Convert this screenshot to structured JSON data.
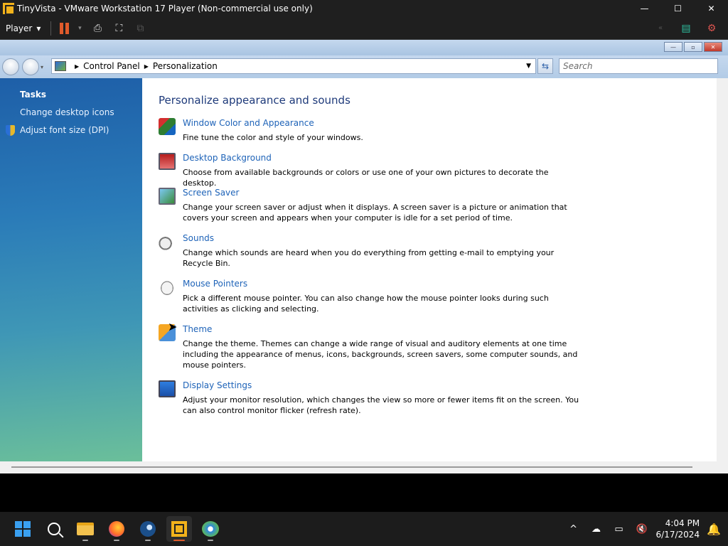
{
  "vm_window": {
    "title": "TinyVista - VMware Workstation 17 Player (Non-commercial use only)",
    "minimize": "—",
    "maximize": "☐",
    "close": "✕"
  },
  "vm_toolbar": {
    "player_label": "Player",
    "dropdown": "▾"
  },
  "guest": {
    "frame_buttons": [
      "—",
      "▫",
      "✕"
    ],
    "breadcrumb": [
      "Control Panel",
      "Personalization"
    ],
    "search_placeholder": "Search",
    "sidebar": {
      "heading": "Tasks",
      "links": [
        "Change desktop icons",
        "Adjust font size (DPI)"
      ]
    },
    "main": {
      "title": "Personalize appearance and sounds",
      "items": [
        {
          "icon": "color-appearance-icon",
          "link": "Window Color and Appearance",
          "desc": "Fine tune the color and style of your windows."
        },
        {
          "icon": "desktop-background-icon",
          "link": "Desktop Background",
          "desc": "Choose from available backgrounds or colors or use one of your own pictures to decorate the desktop."
        },
        {
          "icon": "screen-saver-icon",
          "link": "Screen Saver",
          "desc": "Change your screen saver or adjust when it displays. A screen saver is a picture or animation that covers your screen and appears when your computer is idle for a set period of time."
        },
        {
          "icon": "sounds-icon",
          "link": "Sounds",
          "desc": "Change which sounds are heard when you do everything from getting e-mail to emptying your Recycle Bin."
        },
        {
          "icon": "mouse-pointers-icon",
          "link": "Mouse Pointers",
          "desc": "Pick a different mouse pointer. You can also change how the mouse pointer looks during such activities as clicking and selecting."
        },
        {
          "icon": "theme-icon",
          "link": "Theme",
          "desc": "Change the theme. Themes can change a wide range of visual and auditory elements at one time including the appearance of menus, icons, backgrounds, screen savers, some computer sounds, and mouse pointers."
        },
        {
          "icon": "display-settings-icon",
          "link": "Display Settings",
          "desc": "Adjust your monitor resolution, which changes the view so more or fewer items fit on the screen. You can also control monitor flicker (refresh rate)."
        }
      ]
    }
  },
  "host_taskbar": {
    "time": "4:04 PM",
    "date": "6/17/2024",
    "tray_chevron": "^"
  }
}
